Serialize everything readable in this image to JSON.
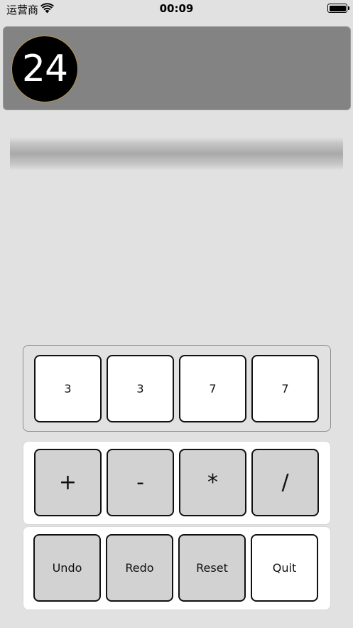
{
  "status_bar": {
    "carrier": "运营商",
    "time": "00:09",
    "wifi_icon": "wifi-icon",
    "battery_icon": "battery-full-icon"
  },
  "header": {
    "target": "24"
  },
  "expression": {
    "text": ""
  },
  "numbers": [
    "3",
    "3",
    "7",
    "7"
  ],
  "operators": [
    "+",
    "-",
    "*",
    "/"
  ],
  "controls": {
    "undo": "Undo",
    "redo": "Redo",
    "reset": "Reset",
    "quit": "Quit"
  },
  "colors": {
    "background": "#e1e1e1",
    "banner": "#838383",
    "badge": "#000000",
    "badge_border": "#b8964c",
    "key_white": "#ffffff",
    "key_gray": "#d2d2d2"
  }
}
